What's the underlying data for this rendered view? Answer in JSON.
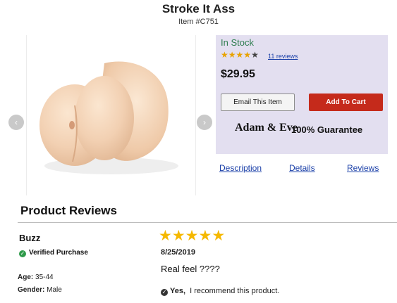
{
  "product": {
    "title": "Stroke It Ass",
    "item_number": "Item #C751"
  },
  "gallery": {
    "prev_arrow": "‹",
    "next_arrow": "›"
  },
  "purchase_panel": {
    "stock_status": "In Stock",
    "rating": {
      "stars_filled": 4,
      "stars_total": 5,
      "review_link": "11 reviews"
    },
    "price": "$29.95",
    "email_button": "Email This Item",
    "cart_button": "Add To Cart",
    "brand_logo": "Adam & Eve",
    "guarantee": "100% Guarantee"
  },
  "tabs": [
    {
      "label": "Description"
    },
    {
      "label": "Details"
    },
    {
      "label": "Reviews"
    }
  ],
  "reviews_section": {
    "title": "Product Reviews",
    "review": {
      "name": "Buzz",
      "verified": "Verified Purchase",
      "age_label": "Age:",
      "age_value": "35-44",
      "gender_label": "Gender:",
      "gender_value": "Male",
      "stars": 5,
      "date": "8/25/2019",
      "text": "Real feel ????",
      "recommend_yes": "Yes,",
      "recommend_text": "I recommend this product."
    }
  },
  "colors": {
    "panel_bg": "#e3dff0",
    "cart_button": "#c52a1b",
    "link": "#1a3fa8",
    "star": "#f5b800",
    "in_stock": "#2e7d4f"
  }
}
